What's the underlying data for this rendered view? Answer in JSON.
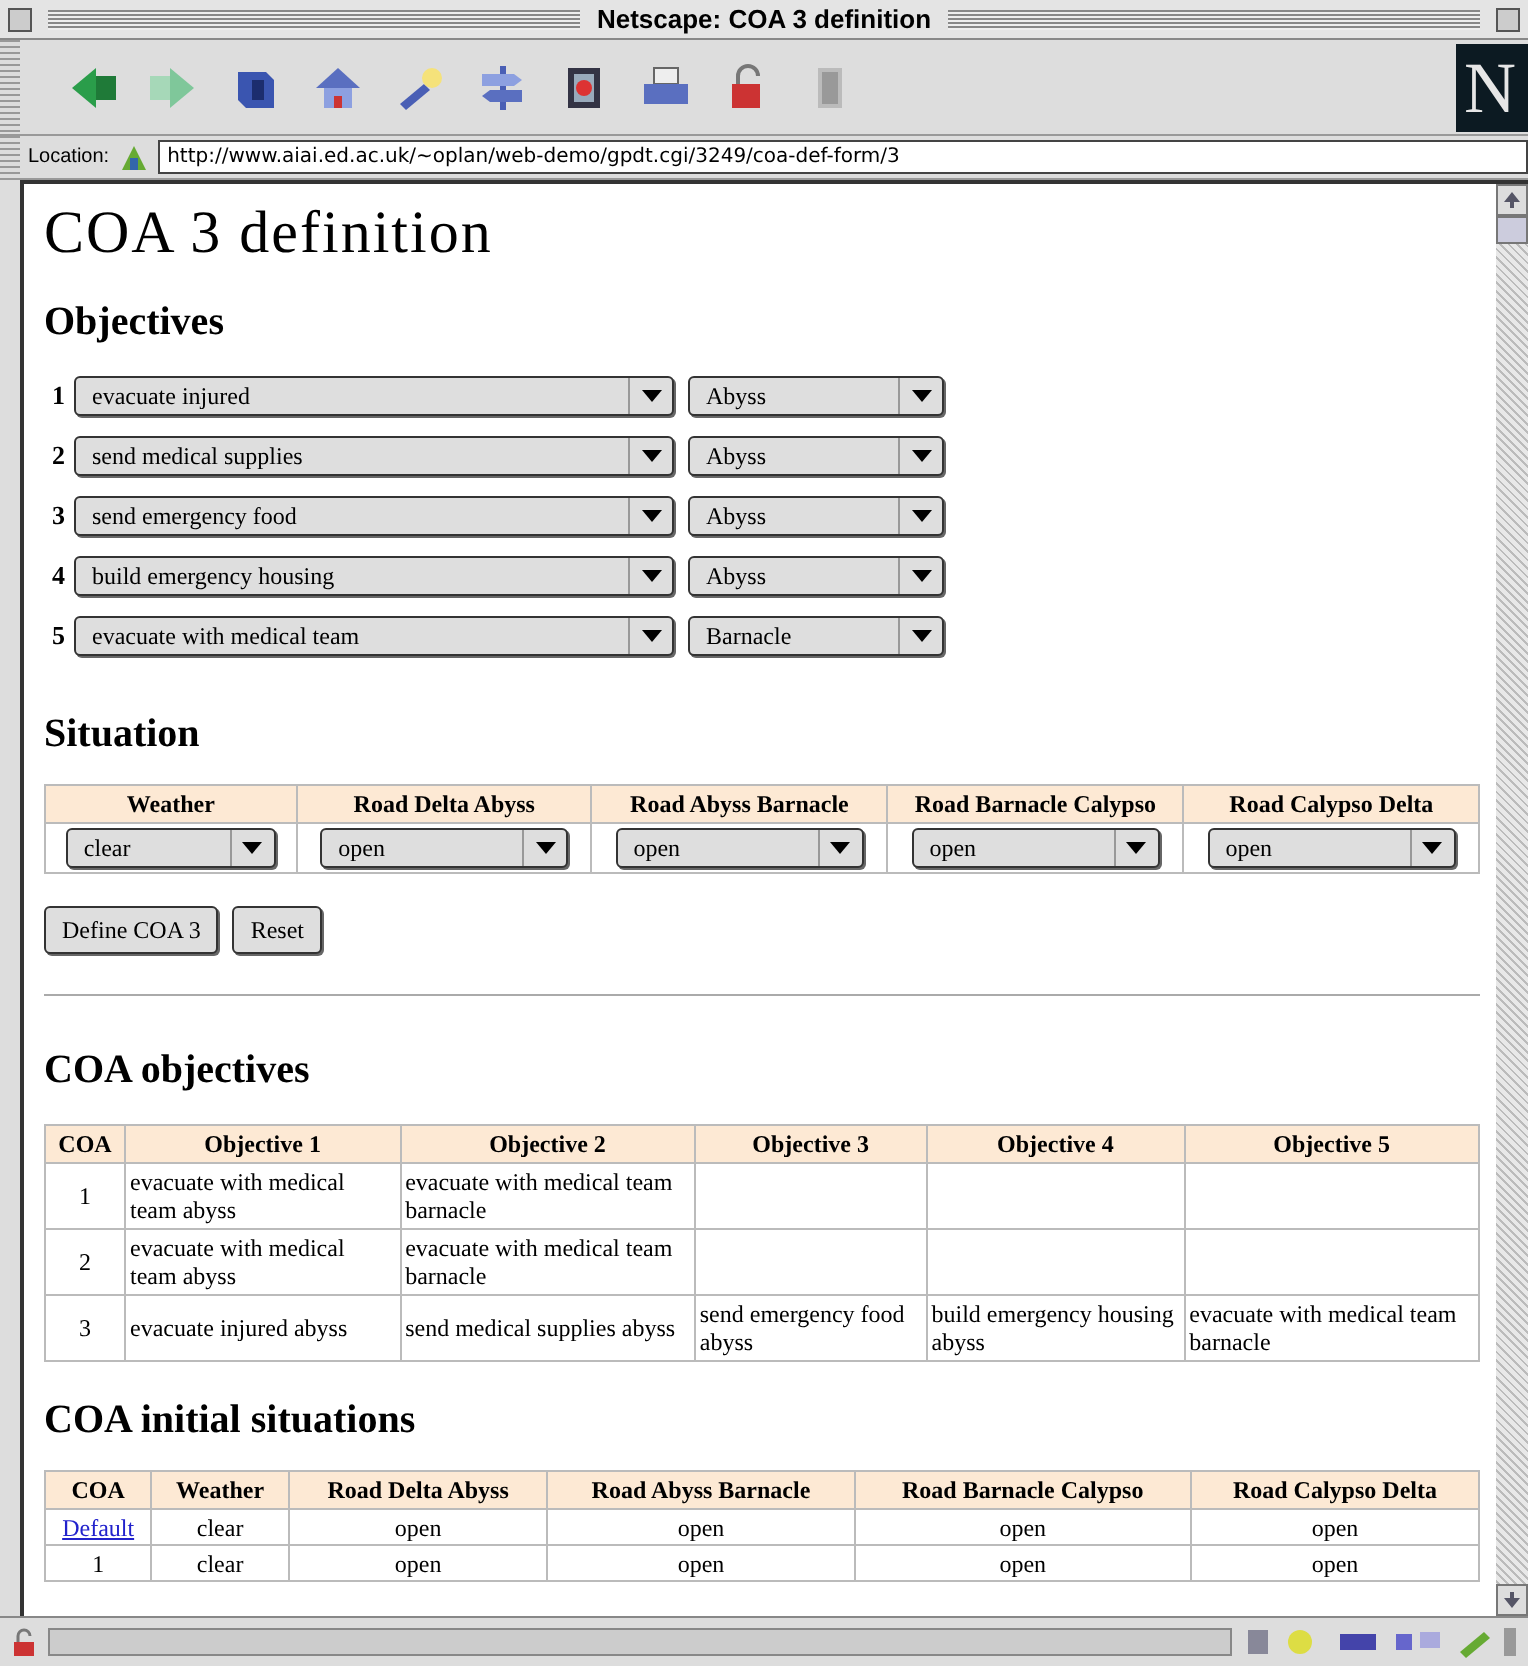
{
  "window": {
    "title": "Netscape: COA 3 definition"
  },
  "logo": "N",
  "location": {
    "label": "Location:",
    "url": "http://www.aiai.ed.ac.uk/~oplan/web-demo/gpdt.cgi/3249/coa-def-form/3"
  },
  "page": {
    "title": "COA 3 definition",
    "objectives": {
      "heading": "Objectives",
      "rows": [
        {
          "number": "1",
          "objective": "evacuate injured",
          "place": "Abyss"
        },
        {
          "number": "2",
          "objective": "send medical supplies",
          "place": "Abyss"
        },
        {
          "number": "3",
          "objective": "send emergency food",
          "place": "Abyss"
        },
        {
          "number": "4",
          "objective": "build emergency housing",
          "place": "Abyss"
        },
        {
          "number": "5",
          "objective": "evacuate with medical team",
          "place": "Barnacle"
        }
      ]
    },
    "situation": {
      "heading": "Situation",
      "columns": [
        "Weather",
        "Road Delta Abyss",
        "Road Abyss Barnacle",
        "Road Barnacle Calypso",
        "Road Calypso Delta"
      ],
      "values": [
        "clear",
        "open",
        "open",
        "open",
        "open"
      ]
    },
    "buttons": [
      "Define COA 3",
      "Reset"
    ],
    "coa_objectives": {
      "heading": "COA objectives",
      "columns": [
        "COA",
        "Objective 1",
        "Objective 2",
        "Objective 3",
        "Objective 4",
        "Objective 5"
      ],
      "rows": [
        [
          "1",
          "evacuate with medical team abyss",
          "evacuate with medical team barnacle",
          null,
          null,
          null
        ],
        [
          "2",
          "evacuate with medical team abyss",
          "evacuate with medical team barnacle",
          null,
          null,
          null
        ],
        [
          "3",
          "evacuate injured abyss",
          "send medical supplies abyss",
          "send emergency food abyss",
          "build emergency housing abyss",
          "evacuate with medical team barnacle"
        ]
      ]
    },
    "initial_situations": {
      "heading": "COA initial situations",
      "columns": [
        "COA",
        "Weather",
        "Road Delta Abyss",
        "Road Abyss Barnacle",
        "Road Barnacle Calypso",
        "Road Calypso Delta"
      ],
      "rows": [
        {
          "link": true,
          "cells": [
            "Default",
            "clear",
            "open",
            "open",
            "open",
            "open"
          ]
        },
        {
          "link": false,
          "cells": [
            "1",
            "clear",
            "open",
            "open",
            "open",
            "open"
          ]
        }
      ]
    }
  }
}
